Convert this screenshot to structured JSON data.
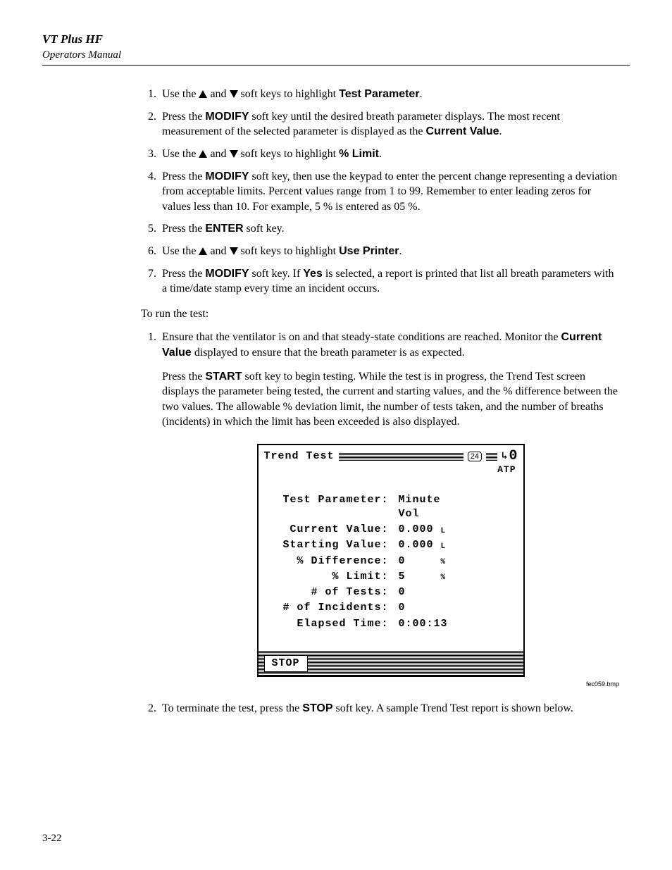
{
  "header": {
    "title": "VT Plus HF",
    "subtitle": "Operators Manual"
  },
  "steps_a": [
    {
      "pre": "Use the ",
      "mid": " soft keys to highlight ",
      "bold": "Test Parameter",
      "post": "."
    },
    {
      "pre": "Press the ",
      "bold1": "MODIFY",
      "mid": " soft key until the desired breath parameter displays. The most recent measurement of the selected parameter is displayed as the ",
      "bold2": "Current Value",
      "post": "."
    },
    {
      "pre": "Use the ",
      "mid": " soft keys to highlight ",
      "bold": "% Limit",
      "post": "."
    },
    {
      "pre": "Press the ",
      "bold": "MODIFY",
      "post": " soft key, then use the keypad to enter the percent change representing a deviation from acceptable limits. Percent values range from 1 to 99. Remember to enter leading zeros for values less than 10. For example, 5 % is entered as 05 %."
    },
    {
      "pre": "Press the ",
      "bold": "ENTER",
      "post": " soft key."
    },
    {
      "pre": "Use the ",
      "mid": " soft keys to highlight ",
      "bold": "Use Printer",
      "post": "."
    },
    {
      "pre": "Press the ",
      "bold1": "MODIFY",
      "mid": " soft key. If ",
      "bold2": "Yes",
      "post": " is selected, a report is printed that list all breath parameters with a time/date stamp every time an incident occurs."
    }
  ],
  "run_intro": "To run the test:",
  "steps_b1": {
    "pre": "Ensure that the ventilator is on and that steady-state conditions are reached. Monitor the ",
    "bold": "Current Value",
    "post": " displayed to ensure that the breath parameter is as expected."
  },
  "steps_b1_p2": {
    "pre": "Press the ",
    "bold": "START",
    "post": " soft key to begin testing. While the test is in progress, the Trend Test screen displays the parameter being tested, the current and starting values, and the % difference between the two values. The allowable % deviation limit, the number of tests taken, and the number of breaths (incidents) in which the limit has been exceeded is also displayed."
  },
  "device": {
    "title": "Trend Test",
    "badge": "24",
    "zero": "0",
    "atp": "ATP",
    "rows": [
      {
        "label": "Test Parameter:",
        "value": "Minute Vol",
        "unit": ""
      },
      {
        "label": "Current Value:",
        "value": "0.000",
        "unit": "L"
      },
      {
        "label": "Starting Value:",
        "value": "0.000",
        "unit": "L"
      },
      {
        "label": "% Difference:",
        "value": "0",
        "unit": "%"
      },
      {
        "label": "% Limit:",
        "value": "5",
        "unit": "%"
      },
      {
        "label": "# of Tests:",
        "value": "0",
        "unit": ""
      },
      {
        "label": "# of Incidents:",
        "value": "0",
        "unit": ""
      },
      {
        "label": "Elapsed Time:",
        "value": "0:00:13",
        "unit": ""
      }
    ],
    "softkey": "STOP"
  },
  "caption": "fec059.bmp",
  "steps_b2": {
    "pre": "To terminate the test, press the ",
    "bold": "STOP",
    "post": " soft key. A sample Trend Test report is shown below."
  },
  "page_num": "3-22"
}
